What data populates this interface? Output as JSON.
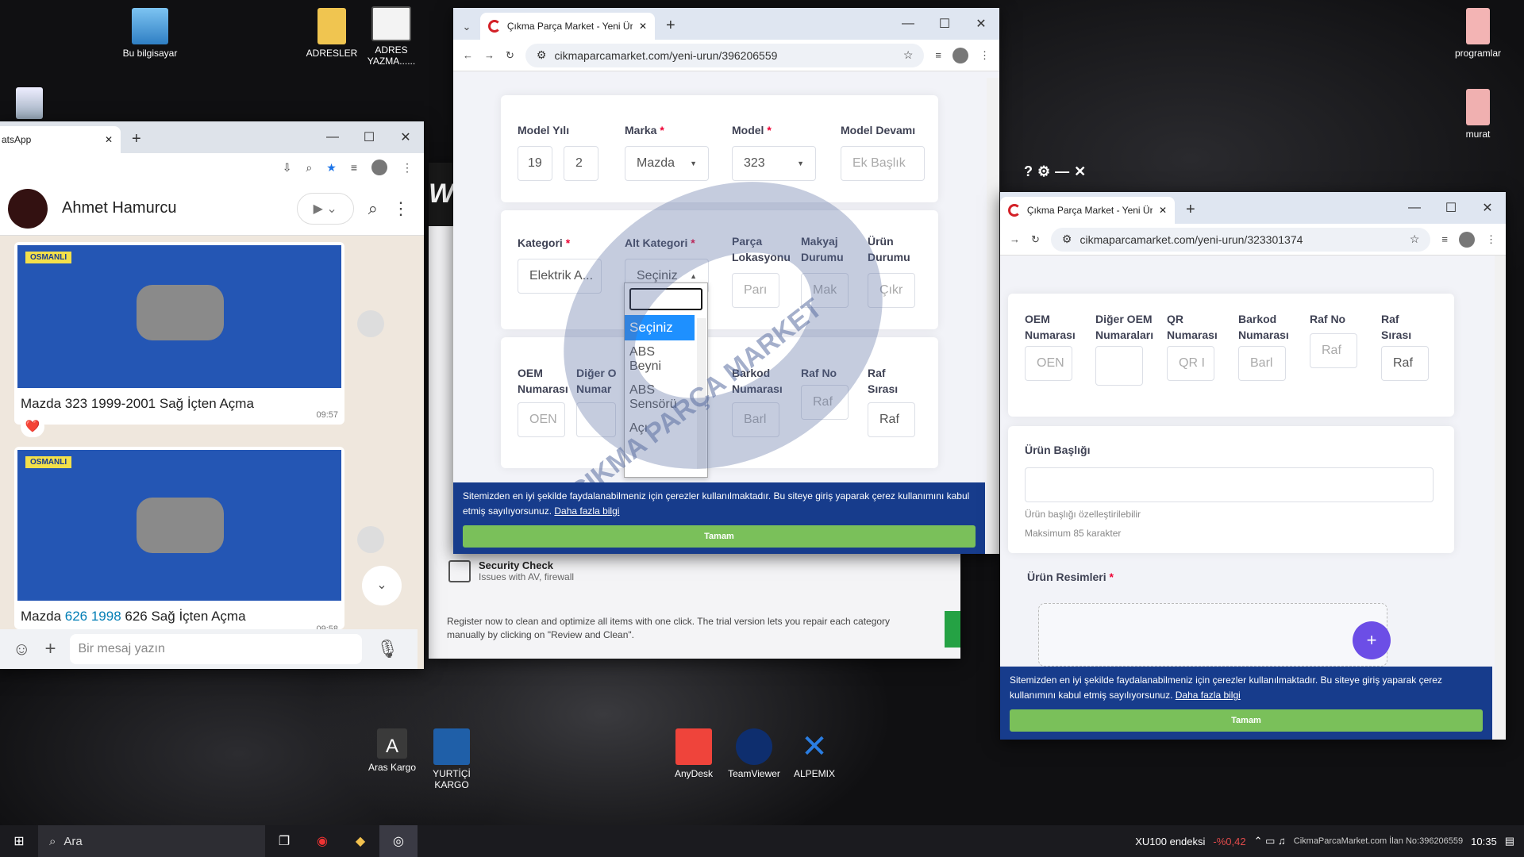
{
  "desktop": {
    "icons": [
      {
        "label": "Bu bilgisayar",
        "color": "#5aaee6"
      },
      {
        "label": "ADRESLER",
        "color": "#f0c550"
      },
      {
        "label": "ADRES YAZMA......",
        "color": "#e8e8e8"
      },
      {
        "label": "programlar",
        "color": "#f3b4b4"
      },
      {
        "label": "murat",
        "color": "#f0b0b0"
      },
      {
        "label": "Aras Kargo",
        "color": "#3a3a3a"
      },
      {
        "label": "YURTİÇİ KARGO",
        "color": "#1f5fa8"
      },
      {
        "label": "AnyDesk",
        "color": "#ef443b"
      },
      {
        "label": "TeamViewer",
        "color": "#0e8ee9"
      },
      {
        "label": "ALPEMIX",
        "color": "#2a7de1"
      }
    ],
    "recycle": "recycle-bin"
  },
  "whatsapp": {
    "tab_title": "atsApp",
    "contact": "Ahmet Hamurcu",
    "msg1": "Mazda 323 1999-2001  Sağ İçten Açma",
    "msg1_time": "09:57",
    "msg2_prefix": "Mazda ",
    "msg2_link": "626 1998",
    "msg2_suffix": " 626 Sağ İçten Açma",
    "msg2_time": "09:58",
    "reaction": "❤️",
    "input_placeholder": "Bir mesaj yazın",
    "sticker_brand": "OSMANLI"
  },
  "bg_app": {
    "logo": "W",
    "security_title": "Security Check",
    "security_sub": "Issues with AV, firewall",
    "register": "Register now to clean and optimize all items with one click. The trial version lets you repair each category manually by clicking on \"Review and Clean\"."
  },
  "browser1": {
    "tab": "Çıkma Parça Market - Yeni Ürün",
    "url": "cikmaparcamarket.com/yeni-urun/396206559",
    "fields1": [
      {
        "label": "Model Yılı",
        "value": "19",
        "value2": "2"
      },
      {
        "label": "Marka",
        "value": "Mazda"
      },
      {
        "label": "Model",
        "value": "323"
      },
      {
        "label": "Model Devamı",
        "placeholder": "Ek Başlık"
      }
    ],
    "fields2": [
      {
        "label": "Kategori",
        "value": "Elektrik A..."
      },
      {
        "label": "Alt Kategori",
        "value": "Seçiniz"
      },
      {
        "label": "Parça Lokasyonu",
        "placeholder": "Parı"
      },
      {
        "label": "Makyaj Durumu",
        "placeholder": "Mak"
      },
      {
        "label": "Ürün Durumu",
        "placeholder": "Çıkr"
      }
    ],
    "fields3": [
      {
        "label": "OEM Numarası",
        "placeholder": "OEN"
      },
      {
        "label": "Diğer OEM Numaraları",
        "placeholder": ""
      },
      {
        "label": "QR Numarası",
        "placeholder": ""
      },
      {
        "label": "Barkod Numarası",
        "placeholder": "Barl"
      },
      {
        "label": "Raf No",
        "placeholder": "Raf"
      },
      {
        "label": "Raf Sırası",
        "placeholder": "Raf"
      }
    ],
    "label3_diger": "Diğer O",
    "label3_numar": "Numar",
    "dropdown": {
      "options": [
        "Seçiniz",
        "ABS Beyni",
        "ABS Sensörü",
        "Açı"
      ],
      "selected": "Seçiniz"
    },
    "cookie": "Sitemizden en iyi şekilde faydalanabilmeniz için çerezler kullanılmaktadır. Bu siteye giriş yaparak çerez kullanımını kabul etmiş sayılıyorsunuz.",
    "cookie_link": "Daha fazla bilgi",
    "cookie_btn": "Tamam",
    "watermark": "ÇIKMA PARÇA MARKET"
  },
  "browser2": {
    "tab": "Çıkma Parça Market - Yeni Ürün",
    "url": "cikmaparcamarket.com/yeni-urun/323301374",
    "fields": [
      {
        "label": "OEM Numarası",
        "placeholder": "OEN"
      },
      {
        "label": "Diğer OEM Numaraları",
        "placeholder": ""
      },
      {
        "label": "QR Numarası",
        "placeholder": "QR I"
      },
      {
        "label": "Barkod Numarası",
        "placeholder": "Barl"
      },
      {
        "label": "Raf No",
        "placeholder": "Raf"
      },
      {
        "label": "Raf Sırası",
        "placeholder": "Raf"
      }
    ],
    "title_label": "Ürün Başlığı",
    "hint1": "Ürün başlığı özelleştirilebilir",
    "hint2": "Maksimum 85 karakter",
    "images_label": "Ürün Resimleri",
    "add": "+",
    "cookie": "Sitemizden en iyi şekilde faydalanabilmeniz için çerezler kullanılmaktadır. Bu siteye giriş yaparak çerez kullanımını kabul etmiş sayılıyorsunuz.",
    "cookie_link": "Daha fazla bilgi",
    "cookie_btn": "Tamam"
  },
  "overlay": {
    "help": "?",
    "gear": "⚙",
    "min": "—",
    "close": "✕"
  },
  "taskbar": {
    "search": "Ara",
    "ticker": "XU100 endeksi",
    "ticker_val": "-%0,42",
    "time": "10:35",
    "footer_text": "CikmaParcaMarket.com  İlan No:396206559",
    "colors": {
      "bg": "#1b1b1f",
      "ticker_red": "#e14b4b"
    }
  }
}
